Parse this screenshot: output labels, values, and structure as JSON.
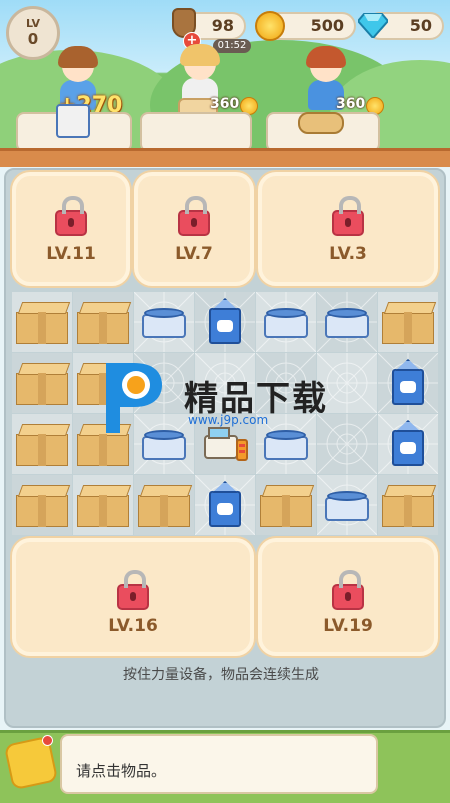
{
  "hud": {
    "level_label": "LV",
    "level_value": "0",
    "energy": "98",
    "energy_timer": "01:52",
    "coins": "500",
    "gems": "50"
  },
  "customers": [
    {
      "reward": "+270",
      "hair": "#a9622e",
      "shirt": "#5aa1e8"
    },
    {
      "reward": "360",
      "hair": "#f0c46a",
      "shirt": "#f0f0f0"
    },
    {
      "reward": "360",
      "hair": "#c4582e",
      "shirt": "#4a92e0"
    }
  ],
  "locked_zones": [
    {
      "label": "LV.11"
    },
    {
      "label": "LV.7"
    },
    {
      "label": "LV.3"
    },
    {
      "label": "LV.16"
    },
    {
      "label": "LV.19"
    }
  ],
  "grid_rows": [
    [
      "box",
      "box",
      "yogurt",
      "milk",
      "yogurt",
      "yogurt",
      "box"
    ],
    [
      "box",
      "box",
      "empty",
      "empty",
      "empty",
      "empty",
      "milk"
    ],
    [
      "box",
      "box",
      "yogurt",
      "register",
      "yogurt",
      "empty",
      "milk"
    ],
    [
      "box",
      "box",
      "box",
      "milk",
      "box",
      "yogurt",
      "box"
    ]
  ],
  "watermark": {
    "title": "精品下载",
    "url": "www.j9p.com"
  },
  "hint_text": "按住力量设备，物品会连续生成",
  "message_text": "请点击物品。",
  "colors": {
    "accent": "#f6c93a",
    "lock_red": "#ea4d5e",
    "level_brown": "#8b5a2b"
  }
}
